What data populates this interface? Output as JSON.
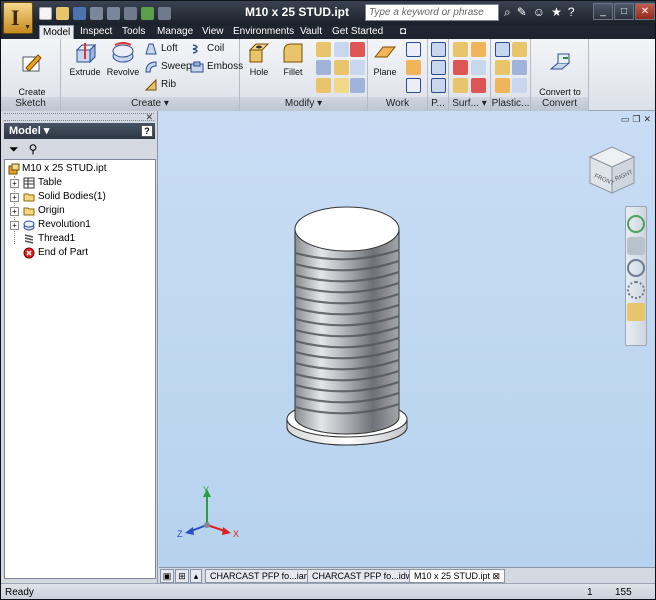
{
  "window": {
    "title": "M10 x 25 STUD.ipt"
  },
  "search": {
    "placeholder": "Type a keyword or phrase"
  },
  "tabs": [
    {
      "label": "Model"
    },
    {
      "label": "Inspect"
    },
    {
      "label": "Tools"
    },
    {
      "label": "Manage"
    },
    {
      "label": "View"
    },
    {
      "label": "Environments"
    },
    {
      "label": "Vault"
    },
    {
      "label": "Get Started"
    }
  ],
  "ribbon": {
    "sketch": {
      "title": "Sketch",
      "create_sketch": "Create\n2D Sketch"
    },
    "create": {
      "title": "Create",
      "extrude": "Extrude",
      "revolve": "Revolve",
      "loft": "Loft",
      "sweep": "Sweep",
      "rib": "Rib",
      "coil": "Coil",
      "emboss": "Emboss"
    },
    "modify": {
      "title": "Modify",
      "hole": "Hole",
      "fillet": "Fillet"
    },
    "work": {
      "title": "Work Features",
      "plane": "Plane"
    },
    "pattern": {
      "title": "P..."
    },
    "surface": {
      "title": "Surf..."
    },
    "plastic": {
      "title": "Plastic..."
    },
    "convert": {
      "title": "Convert",
      "sheet_metal": "Convert to\nSheet Metal"
    }
  },
  "browser": {
    "title": "Model",
    "help": "?",
    "tree": [
      {
        "label": "M10 x 25 STUD.ipt"
      },
      {
        "label": "Table"
      },
      {
        "label": "Solid Bodies(1)"
      },
      {
        "label": "Origin"
      },
      {
        "label": "Revolution1"
      },
      {
        "label": "Thread1"
      },
      {
        "label": "End of Part"
      }
    ]
  },
  "viewcube": {
    "front": "FRONT",
    "right": "RIGHT"
  },
  "axes": {
    "x": "X",
    "y": "Y",
    "z": "Z"
  },
  "doctabs": [
    {
      "label": "CHARCAST PFP fo...iam"
    },
    {
      "label": "CHARCAST PFP fo...idw"
    },
    {
      "label": "M10 x 25 STUD.ipt"
    }
  ],
  "status": {
    "text": "Ready",
    "value1": "1",
    "value2": "155"
  },
  "colors": {
    "titlebar": "#1b2129",
    "viewport": "#c8ddf4",
    "accent": "#e8a21d"
  }
}
